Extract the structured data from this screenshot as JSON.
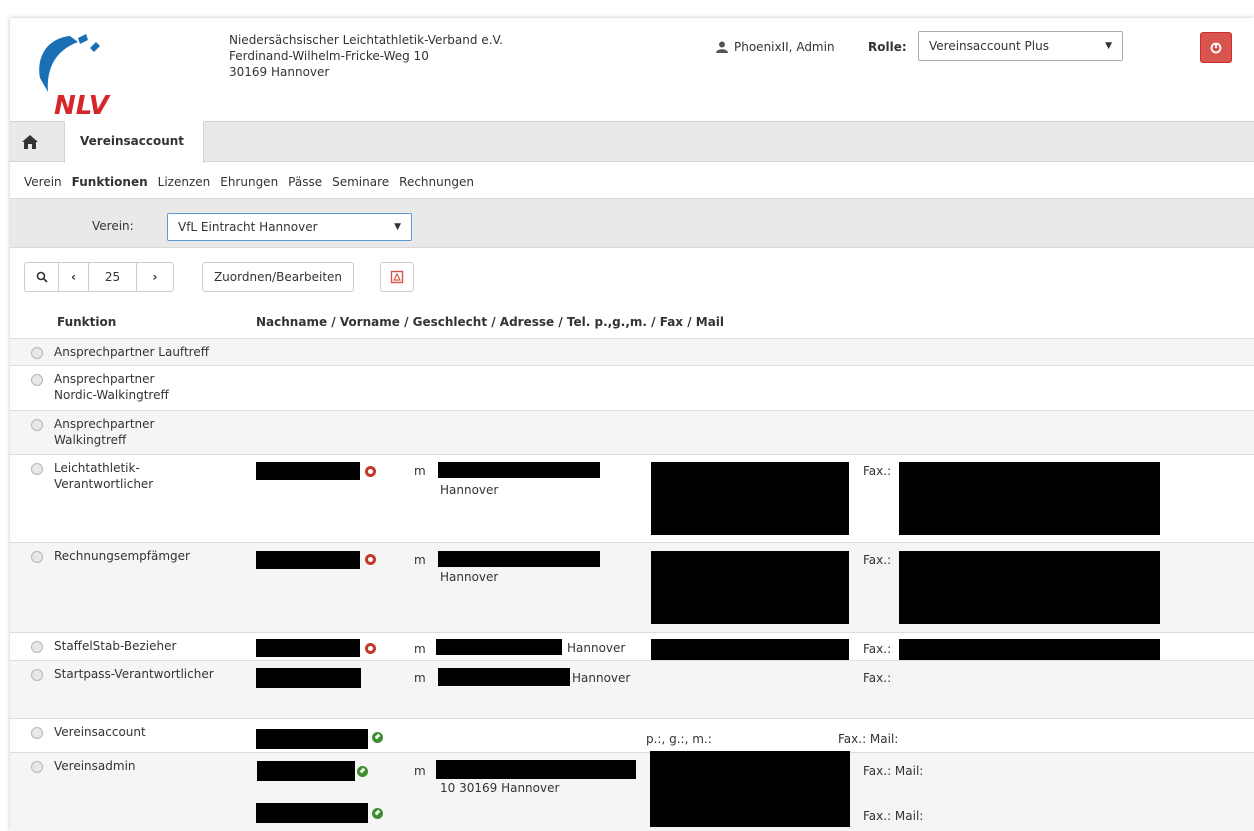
{
  "header": {
    "logo_text": "NLV",
    "org_name": "Niedersächsischer Leichtathletik-Verband e.V.",
    "street": "Ferdinand-Wilhelm-Fricke-Weg 10",
    "city": "30169 Hannover",
    "user": "PhoenixII, Admin",
    "rolle_label": "Rolle:",
    "rolle_value": "Vereinsaccount Plus"
  },
  "tabs": {
    "home_icon": "home-icon",
    "active": "Vereinsaccount"
  },
  "subnav": [
    "Verein",
    "Funktionen",
    "Lizenzen",
    "Ehrungen",
    "Pässe",
    "Seminare",
    "Rechnungen"
  ],
  "filter": {
    "label": "Verein:",
    "value": "VfL Eintracht Hannover"
  },
  "toolbar": {
    "page_size": "25",
    "assign_label": "Zuordnen/Bearbeiten"
  },
  "table": {
    "col_funktion": "Funktion",
    "col_details": "Nachname / Vorname / Geschlecht / Adresse / Tel. p.,g.,m. / Fax / Mail",
    "rows": [
      {
        "funktion": "Ansprechpartner Lauftreff"
      },
      {
        "funktion": "Ansprechpartner Nordic-Walkingtreff"
      },
      {
        "funktion": "Ansprechpartner Walkingtreff"
      },
      {
        "funktion": "Leichtathletik-Verantwortlicher",
        "gender": "m",
        "city": "Hannover",
        "fax": "Fax.:"
      },
      {
        "funktion": "Rechnungsempfämger",
        "gender": "m",
        "city": "Hannover",
        "fax": "Fax.:"
      },
      {
        "funktion": "StaffelStab-Bezieher",
        "gender": "m",
        "city": "Hannover",
        "fax": "Fax.:"
      },
      {
        "funktion": "Startpass-Verantwortlicher",
        "gender": "m",
        "city": "Hannover",
        "fax": "Fax.:"
      },
      {
        "funktion": "Vereinsaccount",
        "phones": "p.:, g.:, m.:",
        "fax_mail": "Fax.:  Mail:"
      },
      {
        "funktion": "Vereinsadmin",
        "gender": "m",
        "address": "10 30169 Hannover",
        "fax_mail": "Fax.:  Mail:",
        "fax_mail_2": "Fax.:  Mail:"
      }
    ]
  }
}
